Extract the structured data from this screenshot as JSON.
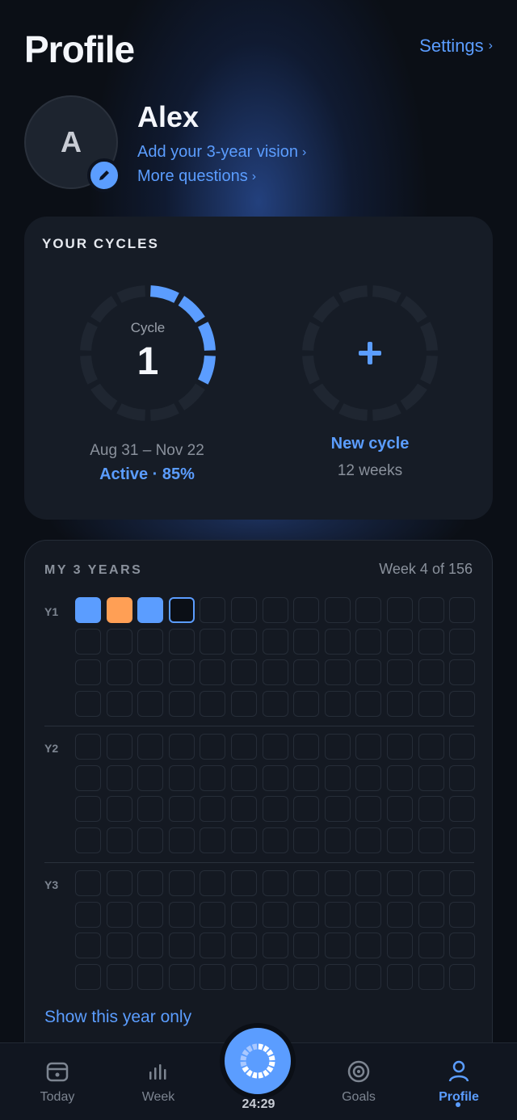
{
  "header": {
    "title": "Profile",
    "settings_label": "Settings"
  },
  "profile": {
    "initial": "A",
    "name": "Alex",
    "vision_link": "Add your 3-year vision",
    "questions_link": "More questions"
  },
  "cycles": {
    "section_title": "YOUR CYCLES",
    "current": {
      "label": "Cycle",
      "number": "1",
      "dates": "Aug 31 – Nov 22",
      "status": "Active · 85%",
      "progress_fraction": 0.33
    },
    "new": {
      "icon": "plus-icon",
      "label": "New cycle",
      "sub": "12 weeks"
    }
  },
  "years": {
    "section_title": "MY 3 YEARS",
    "week_of": "Week 4 of 156",
    "year_labels": [
      "Y1",
      "Y2",
      "Y3"
    ],
    "weeks_per_year": 52,
    "filled_weeks": [
      {
        "week": 1,
        "color": "#5b9dff"
      },
      {
        "week": 2,
        "color": "#ff9f55"
      },
      {
        "week": 3,
        "color": "#5b9dff"
      }
    ],
    "current_week": 4,
    "show_year_link": "Show this year only"
  },
  "tabbar": {
    "today": "Today",
    "week": "Week",
    "timer": "24:29",
    "goals": "Goals",
    "profile": "Profile"
  },
  "colors": {
    "accent": "#5b9dff",
    "orange": "#ff9f55",
    "background": "#0b0f16",
    "card": "#161c26"
  }
}
